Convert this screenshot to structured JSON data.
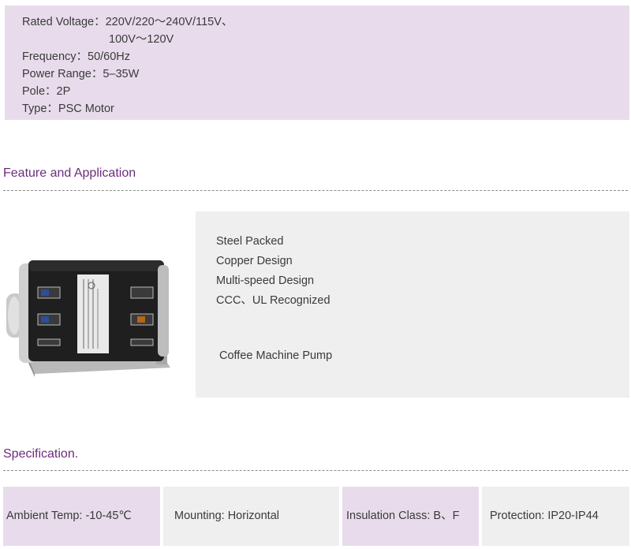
{
  "electrical": {
    "rated_voltage_label": "Rated Voltage：",
    "rated_voltage_value": "220V/220～240V/115V、",
    "rated_voltage_value2": "100V～120V",
    "frequency": "Frequency：50/60Hz",
    "power_range": "Power Range：5–35W",
    "pole": "Pole：2P",
    "type": "Type：PSC Motor"
  },
  "feature_section": {
    "title": "Feature and Application",
    "features": [
      "Steel Packed",
      "Copper Design",
      "Multi-speed Design",
      "CCC、UL Recognized"
    ],
    "application": "Coffee Machine Pump"
  },
  "specification_section": {
    "title": "Specification.",
    "cells": [
      {
        "text": "Ambient Temp: -10-45℃",
        "tone": "purple"
      },
      {
        "text": "Mounting: Horizontal",
        "tone": "grey"
      },
      {
        "text": "Insulation Class: B、F",
        "tone": "purple"
      },
      {
        "text": "Protection: IP20-IP44",
        "tone": "grey"
      }
    ]
  },
  "colors": {
    "accent_purple": "#6b2c7c",
    "panel_purple": "#e8dcec",
    "panel_grey": "#efefef"
  },
  "image": {
    "icon": "motor-product-photo"
  }
}
